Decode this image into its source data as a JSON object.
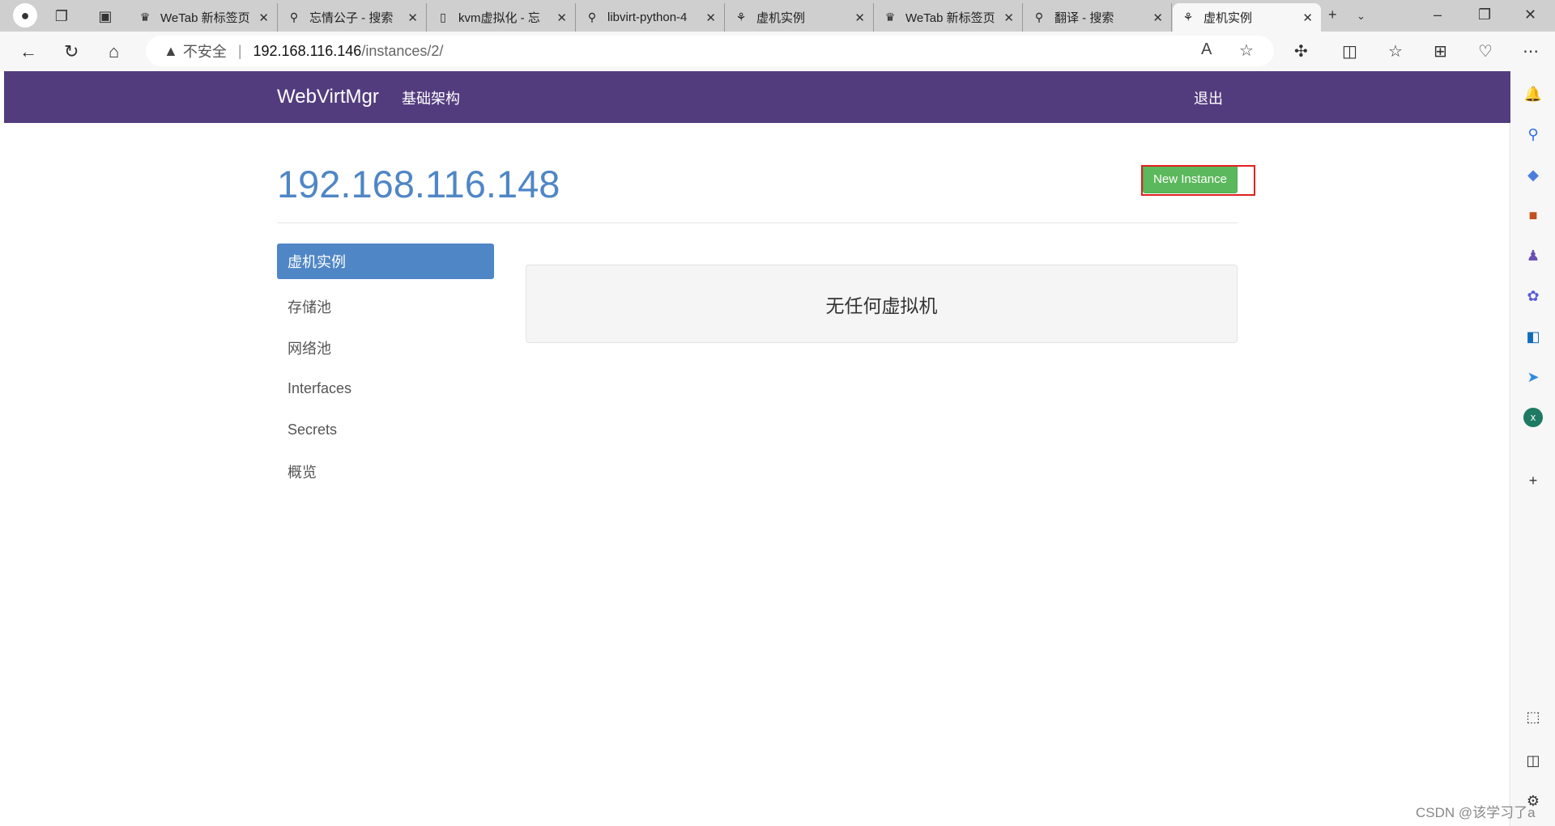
{
  "browser": {
    "tabs": [
      {
        "label": "WeTab 新标签页",
        "icon": "crown-icon"
      },
      {
        "label": "忘情公子 - 搜索",
        "icon": "search-icon"
      },
      {
        "label": "kvm虚拟化 - 忘",
        "icon": "page-icon"
      },
      {
        "label": "libvirt-python-4",
        "icon": "search-icon"
      },
      {
        "label": "虚机实例",
        "icon": "app-icon"
      },
      {
        "label": "WeTab 新标签页",
        "icon": "crown-icon"
      },
      {
        "label": "翻译 - 搜索",
        "icon": "search-icon"
      },
      {
        "label": "虚机实例",
        "icon": "app-icon",
        "active": true
      }
    ],
    "address": {
      "warning": "不安全",
      "host": "192.168.116.146",
      "path": "/instances/2/"
    }
  },
  "navbar": {
    "brand": "WebVirtMgr",
    "infrastructure": "基础架构",
    "logout": "退出",
    "color": "#533c7e"
  },
  "main": {
    "title": "192.168.116.148",
    "new_instance": "New Instance",
    "sidebar": [
      {
        "label": "虚机实例",
        "active": true
      },
      {
        "label": "存储池"
      },
      {
        "label": "网络池"
      },
      {
        "label": "Interfaces"
      },
      {
        "label": "Secrets"
      },
      {
        "label": "概览"
      }
    ],
    "empty_message": "无任何虚拟机"
  },
  "watermark": "CSDN @该学习了a"
}
